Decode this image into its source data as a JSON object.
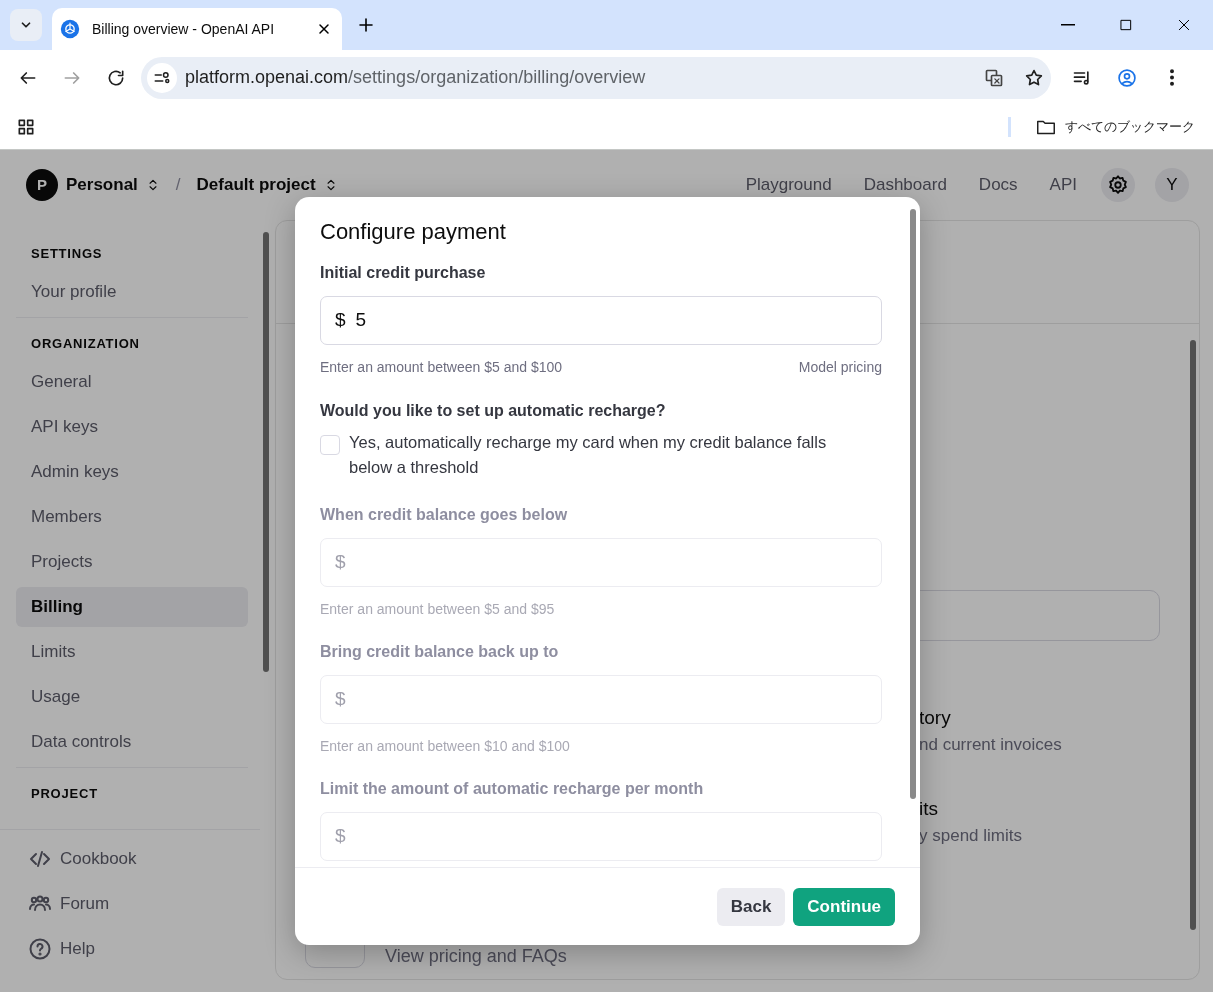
{
  "browser": {
    "tab_title": "Billing overview - OpenAI API",
    "url_host": "platform.openai.com",
    "url_path": "/settings/organization/billing/overview",
    "bookmarks_label": "すべてのブックマーク"
  },
  "header": {
    "org_initial": "P",
    "org": "Personal",
    "separator": "/",
    "project": "Default project",
    "nav": [
      "Playground",
      "Dashboard",
      "Docs",
      "API"
    ],
    "user_initial": "Y"
  },
  "sidebar": {
    "sections": [
      {
        "heading": "SETTINGS",
        "items": [
          {
            "label": "Your profile",
            "selected": false
          }
        ]
      },
      {
        "heading": "ORGANIZATION",
        "items": [
          {
            "label": "General",
            "selected": false
          },
          {
            "label": "API keys",
            "selected": false
          },
          {
            "label": "Admin keys",
            "selected": false
          },
          {
            "label": "Members",
            "selected": false
          },
          {
            "label": "Projects",
            "selected": false
          },
          {
            "label": "Billing",
            "selected": true
          },
          {
            "label": "Limits",
            "selected": false
          },
          {
            "label": "Usage",
            "selected": false
          },
          {
            "label": "Data controls",
            "selected": false
          }
        ]
      },
      {
        "heading": "PROJECT"
      }
    ],
    "footer_links": [
      {
        "kind": "code",
        "label": "Cookbook"
      },
      {
        "kind": "people",
        "label": "Forum"
      },
      {
        "kind": "help",
        "label": "Help"
      }
    ]
  },
  "background": {
    "links": [
      {
        "title": "tory",
        "subtitle": "nd current invoices"
      },
      {
        "title": "its",
        "subtitle": "y spend limits"
      }
    ],
    "pricing_link": "View pricing and FAQs"
  },
  "modal": {
    "title": "Configure payment",
    "purchase": {
      "label": "Initial credit purchase",
      "prefix": "$",
      "value": "5",
      "help": "Enter an amount between $5 and $100",
      "link": "Model pricing"
    },
    "recharge_question": "Would you like to set up automatic recharge?",
    "recharge_option": {
      "label": "Yes, automatically recharge my card when my credit balance falls below a threshold",
      "checked": false
    },
    "recharge_fields": [
      {
        "label": "When credit balance goes below",
        "prefix": "$",
        "help": "Enter an amount between $5 and $95",
        "disabled": true
      },
      {
        "label": "Bring credit balance back up to",
        "prefix": "$",
        "help": "Enter an amount between $10 and $100",
        "disabled": true
      },
      {
        "label": "Limit the amount of automatic recharge per month",
        "prefix": "$",
        "disabled": true
      }
    ],
    "buttons": [
      {
        "kind": "secondary",
        "label": "Back"
      },
      {
        "kind": "primary",
        "label": "Continue"
      }
    ]
  }
}
